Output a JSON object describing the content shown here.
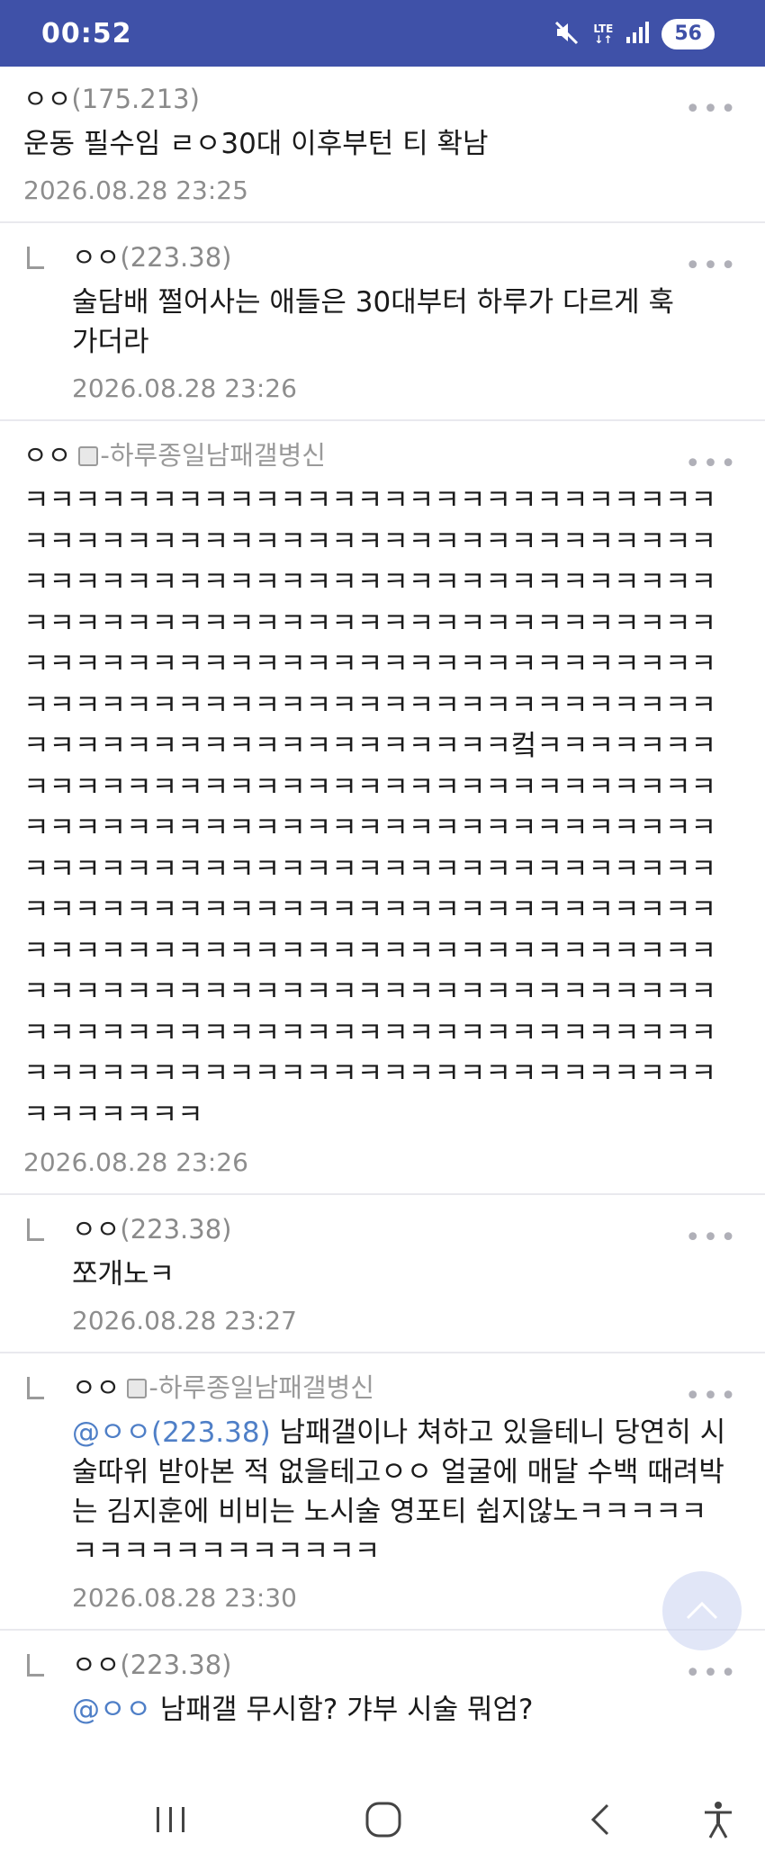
{
  "status_bar": {
    "time": "00:52",
    "network": "LTE",
    "battery": "56"
  },
  "comments": [
    {
      "nick": "ㅇㅇ",
      "ip": "(175.213)",
      "tag": "",
      "text": "운동 필수임 ㄹㅇ30대 이후부턴 티 확남",
      "date": "2026.08.28 23:25",
      "reply": false
    },
    {
      "nick": "ㅇㅇ",
      "ip": "(223.38)",
      "tag": "",
      "text": "술담배 쩔어사는 애들은 30대부터 하루가 다르게 훅 가더라",
      "date": "2026.08.28 23:26",
      "reply": true
    },
    {
      "nick": "ㅇㅇ",
      "ip": "",
      "tag": "-하루종일남패갤병신",
      "text_lines": [
        "ㅋㅋㅋㅋㅋㅋㅋㅋㅋㅋㅋㅋㅋㅋㅋㅋㅋㅋㅋㅋㅋㅋㅋㅋㅋㅋㅋ",
        "ㅋㅋㅋㅋㅋㅋㅋㅋㅋㅋㅋㅋㅋㅋㅋㅋㅋㅋㅋㅋㅋㅋㅋㅋㅋㅋㅋ",
        "ㅋㅋㅋㅋㅋㅋㅋㅋㅋㅋㅋㅋㅋㅋㅋㅋㅋㅋㅋㅋㅋㅋㅋㅋㅋㅋㅋ",
        "ㅋㅋㅋㅋㅋㅋㅋㅋㅋㅋㅋㅋㅋㅋㅋㅋㅋㅋㅋㅋㅋㅋㅋㅋㅋㅋㅋ",
        "ㅋㅋㅋㅋㅋㅋㅋㅋㅋㅋㅋㅋㅋㅋㅋㅋㅋㅋㅋㅋㅋㅋㅋㅋㅋㅋㅋ",
        "ㅋㅋㅋㅋㅋㅋㅋㅋㅋㅋㅋㅋㅋㅋㅋㅋㅋㅋㅋㅋㅋㅋㅋㅋㅋㅋㅋ",
        "ㅋㅋㅋㅋㅋㅋㅋㅋㅋㅋㅋㅋㅋㅋㅋㅋㅋㅋㅋ컼ㅋㅋㅋㅋㅋㅋㅋ",
        "ㅋㅋㅋㅋㅋㅋㅋㅋㅋㅋㅋㅋㅋㅋㅋㅋㅋㅋㅋㅋㅋㅋㅋㅋㅋㅋㅋ",
        "ㅋㅋㅋㅋㅋㅋㅋㅋㅋㅋㅋㅋㅋㅋㅋㅋㅋㅋㅋㅋㅋㅋㅋㅋㅋㅋㅋ",
        "ㅋㅋㅋㅋㅋㅋㅋㅋㅋㅋㅋㅋㅋㅋㅋㅋㅋㅋㅋㅋㅋㅋㅋㅋㅋㅋㅋ",
        "ㅋㅋㅋㅋㅋㅋㅋㅋㅋㅋㅋㅋㅋㅋㅋㅋㅋㅋㅋㅋㅋㅋㅋㅋㅋㅋㅋ",
        "ㅋㅋㅋㅋㅋㅋㅋㅋㅋㅋㅋㅋㅋㅋㅋㅋㅋㅋㅋㅋㅋㅋㅋㅋㅋㅋㅋ",
        "ㅋㅋㅋㅋㅋㅋㅋㅋㅋㅋㅋㅋㅋㅋㅋㅋㅋㅋㅋㅋㅋㅋㅋㅋㅋㅋㅋ",
        "ㅋㅋㅋㅋㅋㅋㅋㅋㅋㅋㅋㅋㅋㅋㅋㅋㅋㅋㅋㅋㅋㅋㅋㅋㅋㅋㅋ",
        "ㅋㅋㅋㅋㅋㅋㅋㅋㅋㅋㅋㅋㅋㅋㅋㅋㅋㅋㅋㅋㅋㅋㅋㅋㅋㅋㅋ",
        "ㅋㅋㅋㅋㅋㅋㅋ"
      ],
      "date": "2026.08.28 23:26",
      "reply": false
    },
    {
      "nick": "ㅇㅇ",
      "ip": "(223.38)",
      "tag": "",
      "text": "쪼개노ㅋ",
      "date": "2026.08.28 23:27",
      "reply": true
    },
    {
      "nick": "ㅇㅇ",
      "ip": "",
      "tag": "-하루종일남패갤병신",
      "mention": "@ㅇㅇ(223.38)",
      "text": " 남패갤이나 쳐하고 있을테니 당연히 시술따위 받아본 적 없을테고ㅇㅇ 얼굴에 매달 수백 때려박는 김지훈에 비비는 노시술 영포티 쉽지않노ㅋㅋㅋㅋㅋㅋㅋㅋㅋㅋㅋㅋㅋㅋㅋㅋㅋ",
      "date": "2026.08.28 23:30",
      "reply": true
    },
    {
      "nick": "ㅇㅇ",
      "ip": "(223.38)",
      "tag": "",
      "mention": "@ㅇㅇ",
      "text": " 남패갤 무시함? 갸부 시술 뭐엄?",
      "reply": true
    }
  ],
  "more_label": "•••",
  "nav": {
    "recent": "recent-apps",
    "home": "home",
    "back": "back",
    "accessibility": "accessibility"
  }
}
